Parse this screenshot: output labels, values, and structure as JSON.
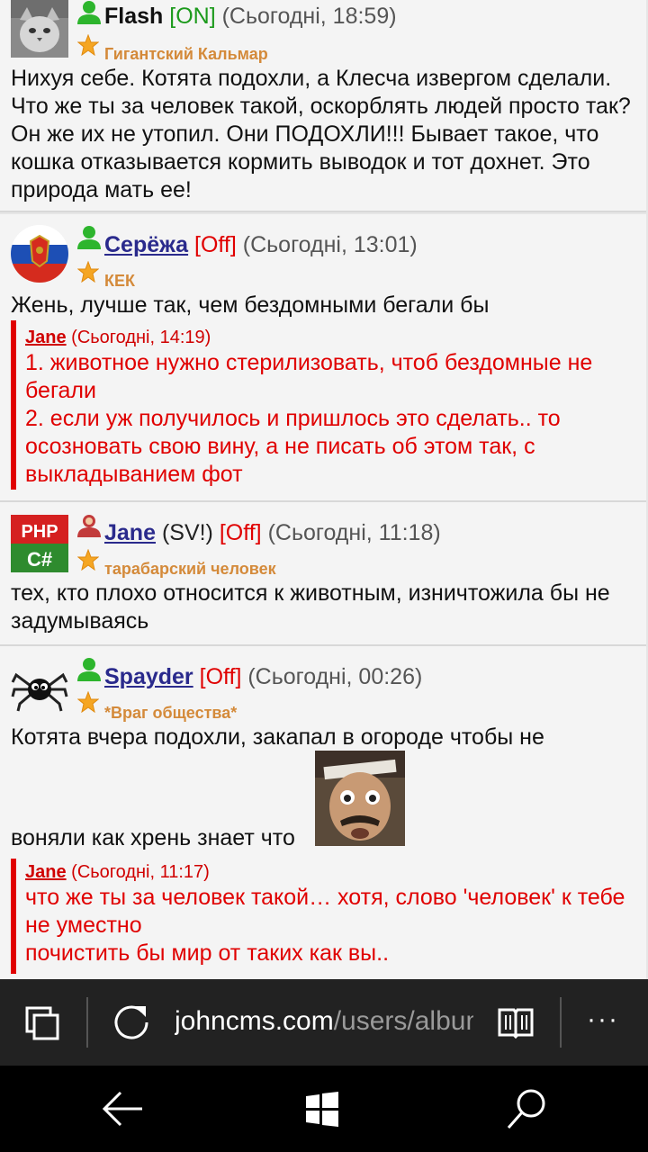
{
  "posts": [
    {
      "name": "Flash",
      "status": "[ON]",
      "time": "(Сьогодні, 18:59)",
      "rank": "Гигантский Кальмар",
      "text": "Нихуя себе. Котята подохли, а Клесча извергом сделали. Что же ты за человек такой, оскорблять людей просто так? Он же их не утопил. Они ПОДОХЛИ!!! Бывает такое, что кошка отказывается кормить выводок и тот дохнет. Это природа мать ее!"
    },
    {
      "name": "Серёжа",
      "status": "[Off]",
      "time": "(Сьогодні, 13:01)",
      "rank": "КЕК",
      "text": "Жень, лучше так, чем бездомными бегали бы",
      "reply": {
        "name": "Jane",
        "time": "(Сьогодні, 14:19)",
        "lines": [
          "1. животное нужно стерилизовать, чтоб бездомные не бегали",
          "2. если уж получилось и пришлось это сделать.. то осозновать свою вину, а не писать об этом так, с выкладыванием фот"
        ]
      }
    },
    {
      "name": "Jane",
      "extra": "(SV!)",
      "status": "[Off]",
      "time": "(Сьогодні, 11:18)",
      "rank": "тарабарский человек",
      "text": "тех, кто плохо относится к животным, изничтожила бы не задумываясь",
      "avatar_top": "PHP",
      "avatar_bottom": "C#"
    },
    {
      "name": "Spayder",
      "status": "[Off]",
      "time": "(Сьогодні, 00:26)",
      "rank": "*Враг общества*",
      "text_line1": "Котята вчера подохли, закапал в огороде чтобы не",
      "text_line2": "воняли как хрень знает что",
      "reply": {
        "name": "Jane",
        "time": "(Сьогодні, 11:17)",
        "lines": [
          "что же ты за человек такой… хотя, слово 'человек' к тебе не уместно",
          "почистить бы мир от таких как вы.."
        ]
      }
    }
  ],
  "browser": {
    "url_domain": "johncms.com",
    "url_path": "/users/album",
    "tabs_icon": "tabs-icon",
    "refresh_icon": "refresh-icon",
    "reading_icon": "reading-view-icon",
    "more_label": "···"
  },
  "colors": {
    "online": "#1c9a1c",
    "offline": "#e00000",
    "rank": "#d48a3a",
    "reply": "#e00000"
  }
}
